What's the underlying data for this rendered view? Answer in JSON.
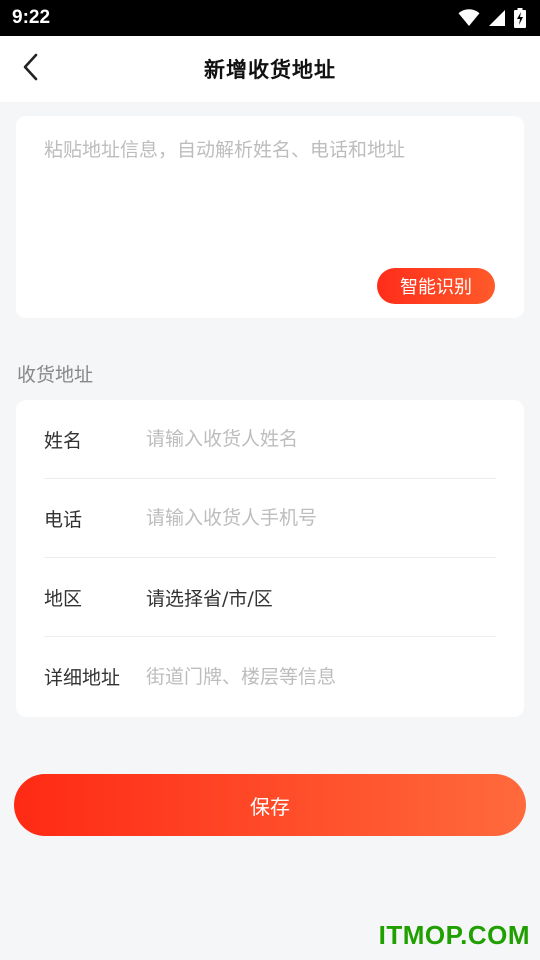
{
  "status_bar": {
    "time": "9:22",
    "icons": [
      "wifi-icon",
      "cell-signal-icon",
      "battery-charging-icon"
    ]
  },
  "header": {
    "title": "新增收货地址",
    "back_icon": "chevron-left-icon"
  },
  "paste_card": {
    "placeholder": "粘贴地址信息，自动解析姓名、电话和地址",
    "recognize_label": "智能识别"
  },
  "section": {
    "label": "收货地址"
  },
  "form": {
    "name": {
      "label": "姓名",
      "placeholder": "请输入收货人姓名"
    },
    "phone": {
      "label": "电话",
      "placeholder": "请输入收货人手机号"
    },
    "region": {
      "label": "地区",
      "value": "请选择省/市/区"
    },
    "detail": {
      "label": "详细地址",
      "placeholder": "街道门牌、楼层等信息"
    }
  },
  "save_label": "保存",
  "watermark": "ITMOP.COM",
  "colors": {
    "accent_start": "#ff2a14",
    "accent_end": "#ff6a3c",
    "watermark": "#20a000"
  }
}
